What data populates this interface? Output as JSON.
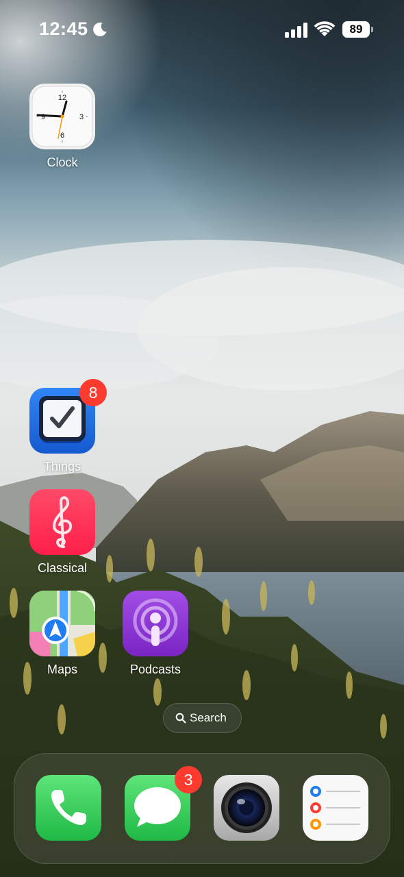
{
  "status_bar": {
    "time": "12:45",
    "focus_icon": "moon-icon",
    "signal_icon": "cellular-signal-icon",
    "wifi_icon": "wifi-icon",
    "battery_level": "89"
  },
  "home_apps": [
    {
      "label": "Clock",
      "icon": "clock-icon"
    },
    {
      "label": "Things",
      "icon": "things-checkmark-icon",
      "badge": "8"
    },
    {
      "label": "Classical",
      "icon": "treble-clef-icon"
    },
    {
      "label": "Maps",
      "icon": "maps-icon"
    },
    {
      "label": "Podcasts",
      "icon": "podcasts-icon"
    }
  ],
  "search": {
    "label": "Search",
    "icon": "magnifier-icon"
  },
  "dock": [
    {
      "app": "Phone",
      "icon": "phone-icon"
    },
    {
      "app": "Messages",
      "icon": "messages-icon",
      "badge": "3"
    },
    {
      "app": "Camera",
      "icon": "camera-lens-icon"
    },
    {
      "app": "Reminders",
      "icon": "reminders-icon"
    }
  ],
  "colors": {
    "badge": "#ff3b30",
    "things_blue": "#1f6fe0",
    "classical_pink": "#ff2d55",
    "podcasts_purple": "#8e3bd6",
    "phone_green": "#34c759"
  }
}
